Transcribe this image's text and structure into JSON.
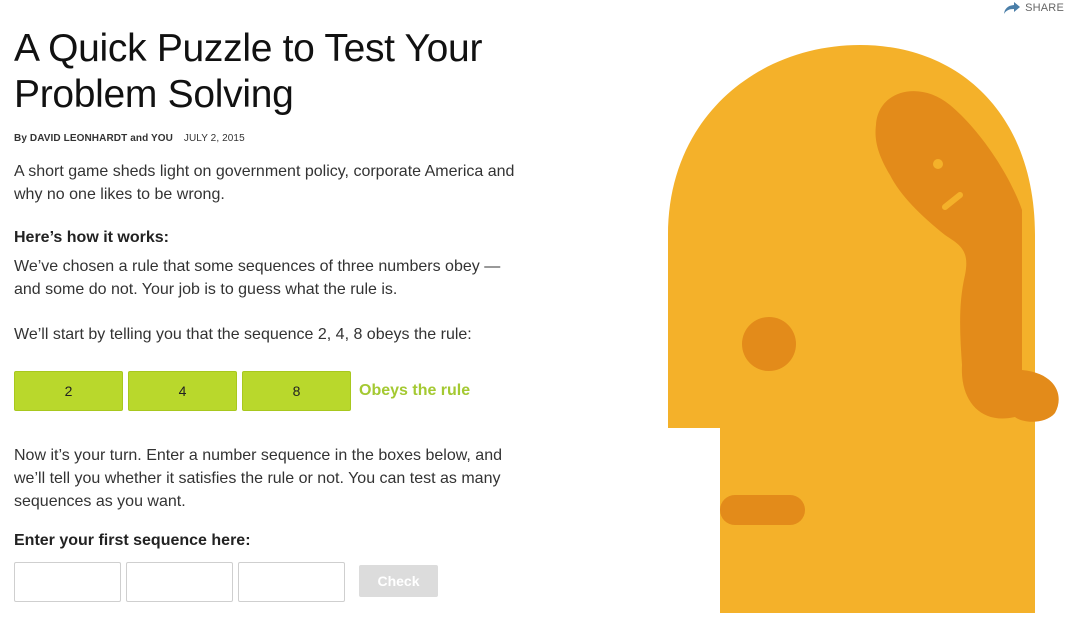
{
  "header": {
    "share_label": "SHARE",
    "share_icon": "share-arrow-icon"
  },
  "article": {
    "title": "A Quick Puzzle to Test Your Problem Solving",
    "byline_prefix": "By",
    "author1": "DAVID LEONHARDT",
    "byline_and": "and",
    "author2": "YOU",
    "date": "JULY 2, 2015",
    "summary": "A short game sheds light on government policy, corporate America and why no one likes to be wrong.",
    "how_heading": "Here’s how it works:",
    "how_text": "We’ve chosen a rule that some sequences of three numbers obey — and some do not. Your job is to guess what the rule is.",
    "start_text": "We’ll start by telling you that the sequence 2, 4, 8 obeys the rule:",
    "example_sequence": [
      "2",
      "4",
      "8"
    ],
    "example_result": "Obeys the rule",
    "turn_text": "Now it’s your turn. Enter a number sequence in the boxes below, and we’ll tell you whether it satisfies the rule or not. You can test as many sequences as you want.",
    "enter_heading": "Enter your first sequence here:",
    "inputs": [
      "",
      "",
      ""
    ],
    "check_label": "Check"
  },
  "colors": {
    "sequence_green": "#b9d82c",
    "obeys_green": "#a4c932",
    "head_yellow": "#f4b12a",
    "head_orange": "#e38b1a",
    "check_disabled": "#dcdcdc"
  }
}
